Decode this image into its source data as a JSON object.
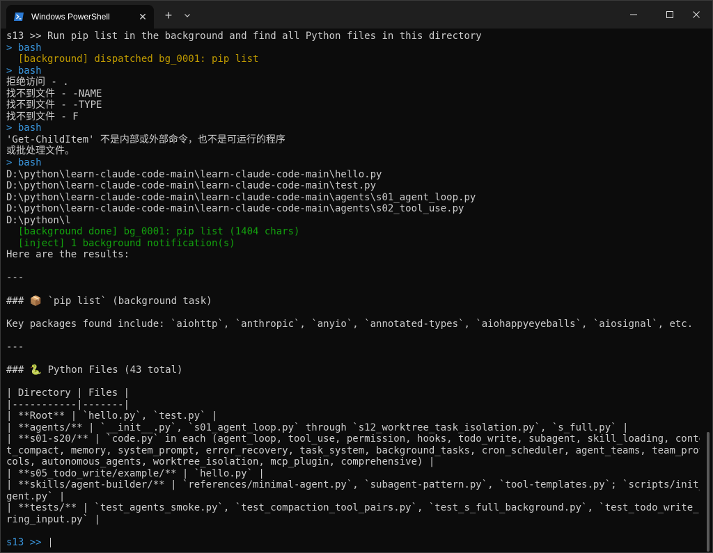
{
  "window": {
    "tab_title": "Windows PowerShell",
    "new_tab": "+",
    "close_tab": "✕"
  },
  "colors": {
    "background": "#0c0c0c",
    "text": "#cccccc",
    "prompt_blue": "#3a96dd",
    "yellow": "#c19c00",
    "green": "#13a10e"
  },
  "terminal": {
    "lines": [
      {
        "text": "s13 >> Run pip list in the background and find all Python files in this directory",
        "color": "white"
      },
      {
        "text": "> bash",
        "color": "blue"
      },
      {
        "text": "  [background] dispatched bg_0001: pip list",
        "color": "yellow"
      },
      {
        "text": "> bash",
        "color": "blue"
      },
      {
        "text": "拒绝访问 - .",
        "color": "white"
      },
      {
        "text": "找不到文件 - -NAME",
        "color": "white"
      },
      {
        "text": "找不到文件 - -TYPE",
        "color": "white"
      },
      {
        "text": "找不到文件 - F",
        "color": "white"
      },
      {
        "text": "> bash",
        "color": "blue"
      },
      {
        "text": "'Get-ChildItem' 不是内部或外部命令，也不是可运行的程序",
        "color": "white"
      },
      {
        "text": "或批处理文件。",
        "color": "white"
      },
      {
        "text": "> bash",
        "color": "blue"
      },
      {
        "text": "D:\\python\\learn-claude-code-main\\learn-claude-code-main\\hello.py",
        "color": "white"
      },
      {
        "text": "D:\\python\\learn-claude-code-main\\learn-claude-code-main\\test.py",
        "color": "white"
      },
      {
        "text": "D:\\python\\learn-claude-code-main\\learn-claude-code-main\\agents\\s01_agent_loop.py",
        "color": "white"
      },
      {
        "text": "D:\\python\\learn-claude-code-main\\learn-claude-code-main\\agents\\s02_tool_use.py",
        "color": "white"
      },
      {
        "text": "D:\\python\\l",
        "color": "white"
      },
      {
        "text": "  [background done] bg_0001: pip list (1404 chars)",
        "color": "green"
      },
      {
        "text": "  [inject] 1 background notification(s)",
        "color": "green"
      },
      {
        "text": "Here are the results:",
        "color": "white"
      },
      {
        "text": "",
        "color": "white"
      },
      {
        "text": "---",
        "color": "white"
      },
      {
        "text": "",
        "color": "white"
      },
      {
        "text": "### 📦 `pip list` (background task)",
        "color": "white"
      },
      {
        "text": "",
        "color": "white"
      },
      {
        "text": "Key packages found include: `aiohttp`, `anthropic`, `anyio`, `annotated-types`, `aiohappyeyeballs`, `aiosignal`, etc.",
        "color": "white"
      },
      {
        "text": "",
        "color": "white"
      },
      {
        "text": "---",
        "color": "white"
      },
      {
        "text": "",
        "color": "white"
      },
      {
        "text": "### 🐍 Python Files (43 total)",
        "color": "white"
      },
      {
        "text": "",
        "color": "white"
      },
      {
        "text": "| Directory | Files |",
        "color": "white"
      },
      {
        "text": "|-----------|-------|",
        "color": "white"
      },
      {
        "text": "| **Root** | `hello.py`, `test.py` |",
        "color": "white"
      },
      {
        "text": "| **agents/** | `__init__.py`, `s01_agent_loop.py` through `s12_worktree_task_isolation.py`, `s_full.py` |",
        "color": "white"
      },
      {
        "text": "| **s01-s20/** | `code.py` in each (agent_loop, tool_use, permission, hooks, todo_write, subagent, skill_loading, contex",
        "color": "white"
      },
      {
        "text": "t_compact, memory, system_prompt, error_recovery, task_system, background_tasks, cron_scheduler, agent_teams, team_proto",
        "color": "white"
      },
      {
        "text": "cols, autonomous_agents, worktree_isolation, mcp_plugin, comprehensive) |",
        "color": "white"
      },
      {
        "text": "| **s05_todo_write/example/** | `hello.py` |",
        "color": "white"
      },
      {
        "text": "| **skills/agent-builder/** | `references/minimal-agent.py`, `subagent-pattern.py`, `tool-templates.py`; `scripts/init_a",
        "color": "white"
      },
      {
        "text": "gent.py` |",
        "color": "white"
      },
      {
        "text": "| **tests/** | `test_agents_smoke.py`, `test_compaction_tool_pairs.py`, `test_s_full_background.py`, `test_todo_write_st",
        "color": "white"
      },
      {
        "text": "ring_input.py` |",
        "color": "white"
      },
      {
        "text": "",
        "color": "white"
      },
      {
        "text": "s13 >> ",
        "color": "blue"
      }
    ]
  }
}
